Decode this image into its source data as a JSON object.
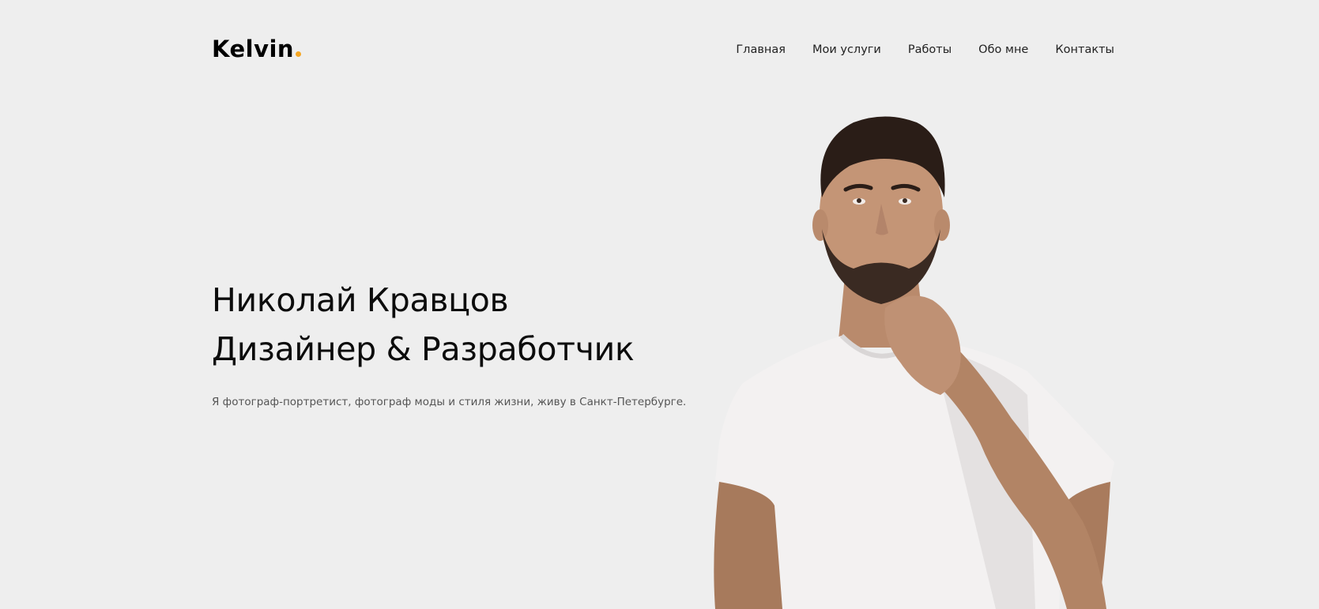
{
  "header": {
    "logo_text": "Kelvin",
    "logo_dot_color": "#f5a623",
    "nav": [
      {
        "label": "Главная"
      },
      {
        "label": "Мои услуги"
      },
      {
        "label": "Работы"
      },
      {
        "label": "Обо мне"
      },
      {
        "label": "Контакты"
      }
    ]
  },
  "hero": {
    "name": "Николай Кравцов",
    "role": "Дизайнер & Разработчик",
    "description": "Я фотограф-портретист, фотограф моды и стиля жизни, живу в Санкт-Петербурге."
  },
  "colors": {
    "background": "#eeeeee",
    "accent": "#f5a623",
    "text": "#0c0c0c"
  }
}
